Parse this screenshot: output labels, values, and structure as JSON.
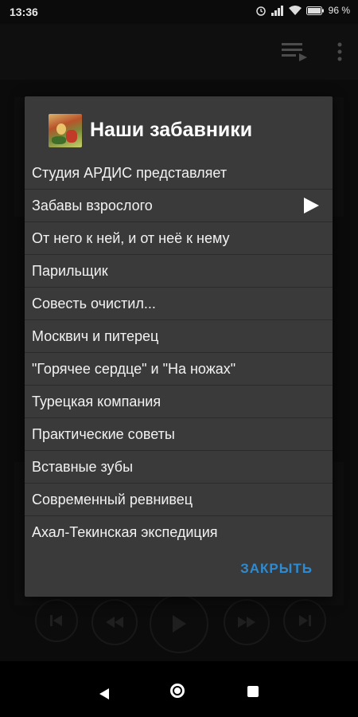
{
  "status_bar": {
    "time": "13:36",
    "battery_percent": "96 %"
  },
  "icons": {
    "queue": "playlist-queue-icon",
    "more": "more-vert-icon",
    "alarm": "alarm-icon",
    "signal": "signal-icon",
    "wifi": "wifi-icon",
    "battery": "battery-icon",
    "play": "play-icon",
    "prev": "skip-previous-icon",
    "rewind": "rewind-icon",
    "forward": "fast-forward-icon",
    "next": "skip-next-icon"
  },
  "dialog": {
    "title": "Наши забавники",
    "items": [
      {
        "label": "Студия АРДИС представляет"
      },
      {
        "label": "Забавы взрослого"
      },
      {
        "label": "От него к ней, и от неё к нему"
      },
      {
        "label": "Парильщик"
      },
      {
        "label": "Совесть очистил..."
      },
      {
        "label": "Москвич и питерец"
      },
      {
        "label": "\"Горячее сердце\" и \"На ножах\""
      },
      {
        "label": "Турецкая компания"
      },
      {
        "label": "Практические советы"
      },
      {
        "label": "Вставные зубы"
      },
      {
        "label": "Современный ревнивец"
      },
      {
        "label": "Ахал-Текинская экспедиция"
      }
    ],
    "playing_index": 1,
    "close_label": "ЗАКРЫТЬ"
  },
  "colors": {
    "dialog_bg": "#3a3a3a",
    "accent": "#2e8bd1"
  }
}
